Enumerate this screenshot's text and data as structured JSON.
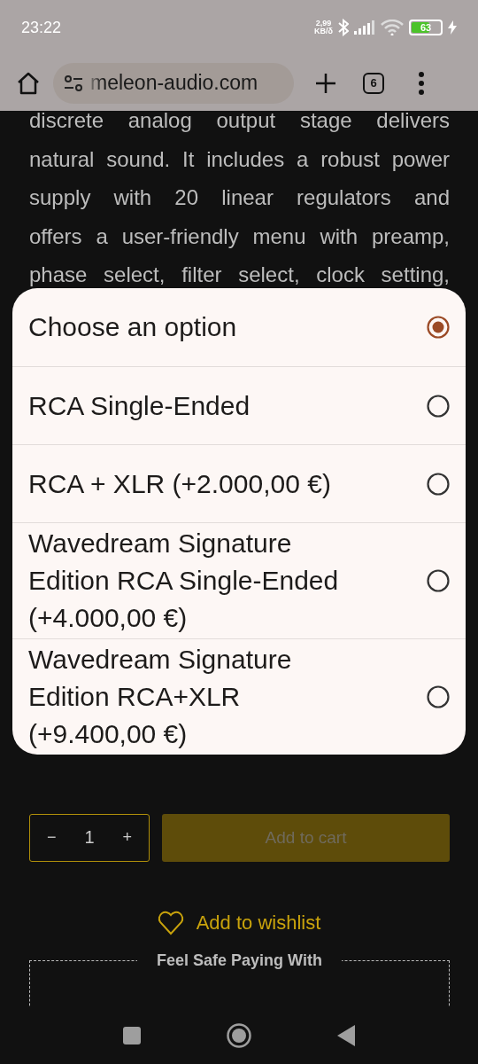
{
  "status_bar": {
    "time": "23:22",
    "net_speed": "2,99",
    "net_unit": "KB/δ",
    "battery": "63"
  },
  "browser": {
    "url": "meleon-audio.com",
    "tab_count": "6"
  },
  "description": {
    "lines": [
      "discrete analog output stage delivers",
      "natural sound. It includes a robust power",
      "supply with 20 linear regulators and",
      "offers a user-friendly menu with preamp,",
      "phase select, filter select, clock setting,"
    ]
  },
  "dialog": {
    "options": [
      {
        "label": "Choose an option",
        "selected": true
      },
      {
        "label": "RCA Single-Ended",
        "selected": false
      },
      {
        "label": "RCA + XLR (+2.000,00 €)",
        "selected": false
      },
      {
        "label": "Wavedream Signature Edition RCA Single-Ended (+4.000,00 €)",
        "selected": false
      },
      {
        "label": "Wavedream Signature Edition RCA+XLR (+9.400,00 €)",
        "selected": false
      }
    ]
  },
  "quantity": {
    "minus": "−",
    "value": "1",
    "plus": "+"
  },
  "add_to_cart": "Add to cart",
  "wishlist": "Add to wishlist",
  "payment": {
    "title": "Feel Safe Paying With"
  }
}
